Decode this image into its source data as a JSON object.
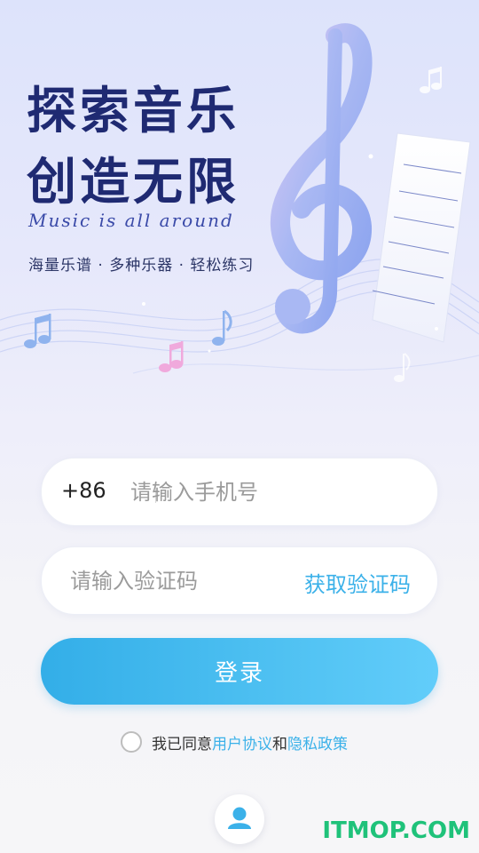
{
  "hero": {
    "title_line1": "探索音乐",
    "title_line2": "创造无限",
    "slogan": "Music is all around",
    "tagline": "海量乐谱 · 多种乐器 · 轻松练习"
  },
  "phone": {
    "prefix": "+86",
    "placeholder": "请输入手机号",
    "value": ""
  },
  "code": {
    "placeholder": "请输入验证码",
    "value": "",
    "get_code_label": "获取验证码"
  },
  "login": {
    "label": "登录"
  },
  "agreement": {
    "checked": false,
    "prefix_text": "我已同意",
    "user_agreement": "用户协议",
    "and_text": "和",
    "privacy_policy": "隐私政策"
  },
  "icons": {
    "other_login": "user-icon"
  },
  "watermark": "ITMOP.COM",
  "colors": {
    "accent": "#3bb1e9",
    "title": "#1f2a72",
    "button_start": "#33aee8",
    "button_end": "#62cdfa",
    "watermark": "#1fc27a"
  }
}
